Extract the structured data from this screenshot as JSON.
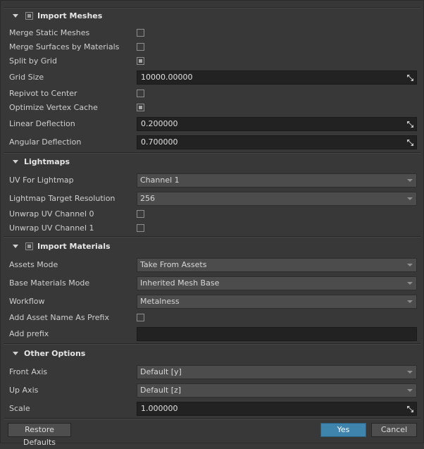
{
  "sections": {
    "import_meshes": "Import Meshes",
    "lightmaps": "Lightmaps",
    "import_materials": "Import Materials",
    "other_options": "Other Options"
  },
  "meshes": {
    "merge_static_meshes": {
      "label": "Merge Static Meshes",
      "checked": false
    },
    "merge_surfaces_by_materials": {
      "label": "Merge Surfaces by Materials",
      "checked": false
    },
    "split_by_grid": {
      "label": "Split by Grid",
      "checked": true
    },
    "grid_size": {
      "label": "Grid Size",
      "value": "10000.00000"
    },
    "repivot_to_center": {
      "label": "Repivot to Center",
      "checked": false
    },
    "optimize_vertex_cache": {
      "label": "Optimize Vertex Cache",
      "checked": true
    },
    "linear_deflection": {
      "label": "Linear Deflection",
      "value": "0.200000"
    },
    "angular_deflection": {
      "label": "Angular Deflection",
      "value": "0.700000"
    }
  },
  "lightmaps": {
    "uv_for_lightmap": {
      "label": "UV For Lightmap",
      "value": "Channel 1"
    },
    "target_resolution": {
      "label": "Lightmap Target Resolution",
      "value": "256"
    },
    "unwrap_uv_0": {
      "label": "Unwrap UV Channel 0",
      "checked": false
    },
    "unwrap_uv_1": {
      "label": "Unwrap UV Channel 1",
      "checked": false
    }
  },
  "materials": {
    "assets_mode": {
      "label": "Assets Mode",
      "value": "Take From Assets"
    },
    "base_materials_mode": {
      "label": "Base Materials Mode",
      "value": "Inherited Mesh Base"
    },
    "workflow": {
      "label": "Workflow",
      "value": "Metalness"
    },
    "add_asset_name_prefix": {
      "label": "Add Asset Name As Prefix",
      "checked": false
    },
    "add_prefix": {
      "label": "Add prefix",
      "value": ""
    }
  },
  "other": {
    "front_axis": {
      "label": "Front Axis",
      "value": "Default [y]"
    },
    "up_axis": {
      "label": "Up Axis",
      "value": "Default [z]"
    },
    "scale": {
      "label": "Scale",
      "value": "1.000000"
    }
  },
  "buttons": {
    "restore_defaults": "Restore Defaults",
    "yes": "Yes",
    "cancel": "Cancel"
  },
  "colors": {
    "background": "#383838",
    "field": "#222222",
    "dropdown": "#4c4c4c",
    "accent": "#3f84ad"
  }
}
